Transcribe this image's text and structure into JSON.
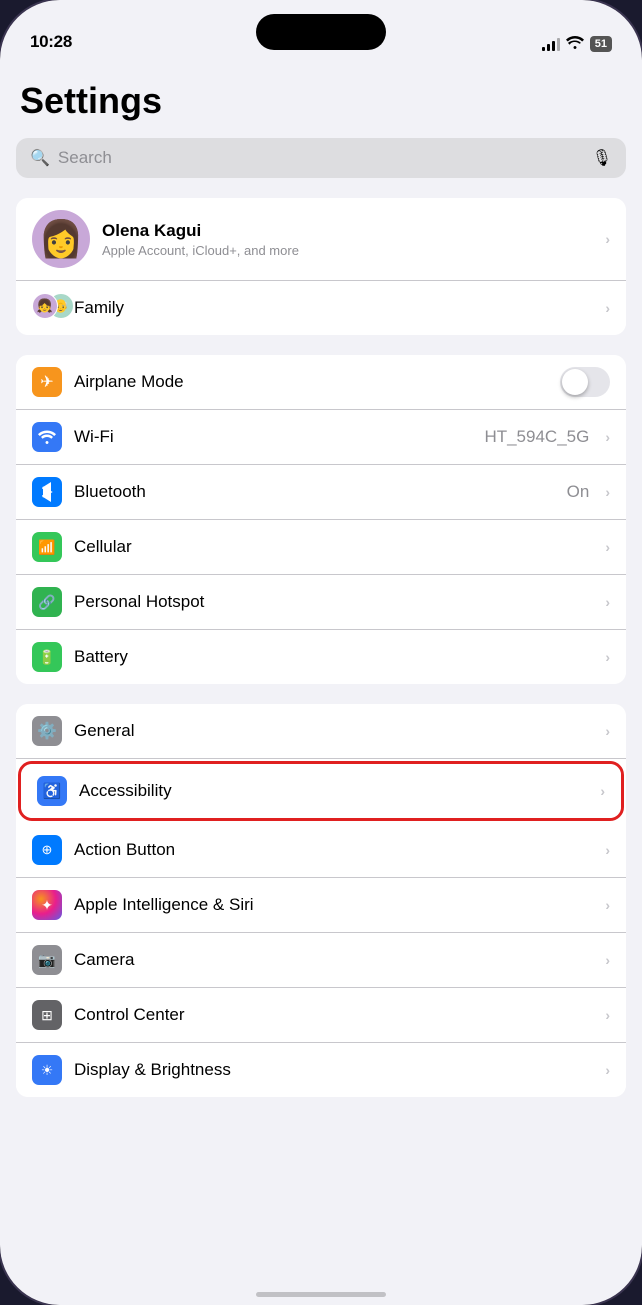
{
  "statusBar": {
    "time": "10:28",
    "battery": "51"
  },
  "pageTitle": "Settings",
  "search": {
    "placeholder": "Search"
  },
  "profile": {
    "name": "Olena Kagui",
    "subtitle": "Apple Account, iCloud+, and more"
  },
  "family": {
    "label": "Family"
  },
  "networkSettings": [
    {
      "id": "airplane-mode",
      "label": "Airplane Mode",
      "value": "",
      "hasToggle": true,
      "iconColor": "orange",
      "iconSymbol": "✈"
    },
    {
      "id": "wifi",
      "label": "Wi-Fi",
      "value": "HT_594C_5G",
      "hasToggle": false,
      "iconColor": "blue",
      "iconSymbol": "wifi"
    },
    {
      "id": "bluetooth",
      "label": "Bluetooth",
      "value": "On",
      "hasToggle": false,
      "iconColor": "blue-dark",
      "iconSymbol": "bt"
    },
    {
      "id": "cellular",
      "label": "Cellular",
      "value": "",
      "hasToggle": false,
      "iconColor": "green",
      "iconSymbol": "cell"
    },
    {
      "id": "personal-hotspot",
      "label": "Personal Hotspot",
      "value": "",
      "hasToggle": false,
      "iconColor": "green-dark",
      "iconSymbol": "hotspot"
    },
    {
      "id": "battery",
      "label": "Battery",
      "value": "",
      "hasToggle": false,
      "iconColor": "green",
      "iconSymbol": "battery"
    }
  ],
  "systemSettings": [
    {
      "id": "general",
      "label": "General",
      "value": "",
      "iconColor": "gray",
      "iconSymbol": "gear",
      "highlighted": false
    },
    {
      "id": "accessibility",
      "label": "Accessibility",
      "value": "",
      "iconColor": "blue",
      "iconSymbol": "access",
      "highlighted": true
    },
    {
      "id": "action-button",
      "label": "Action Button",
      "value": "",
      "iconColor": "blue-dark",
      "iconSymbol": "action",
      "highlighted": false
    },
    {
      "id": "apple-intelligence",
      "label": "Apple Intelligence & Siri",
      "value": "",
      "iconColor": "multi",
      "iconSymbol": "siri",
      "highlighted": false
    },
    {
      "id": "camera",
      "label": "Camera",
      "value": "",
      "iconColor": "camera-gray",
      "iconSymbol": "camera",
      "highlighted": false
    },
    {
      "id": "control-center",
      "label": "Control Center",
      "value": "",
      "iconColor": "gray-dark",
      "iconSymbol": "control",
      "highlighted": false
    },
    {
      "id": "display-brightness",
      "label": "Display & Brightness",
      "value": "",
      "iconColor": "blue",
      "iconSymbol": "display",
      "highlighted": false
    }
  ]
}
